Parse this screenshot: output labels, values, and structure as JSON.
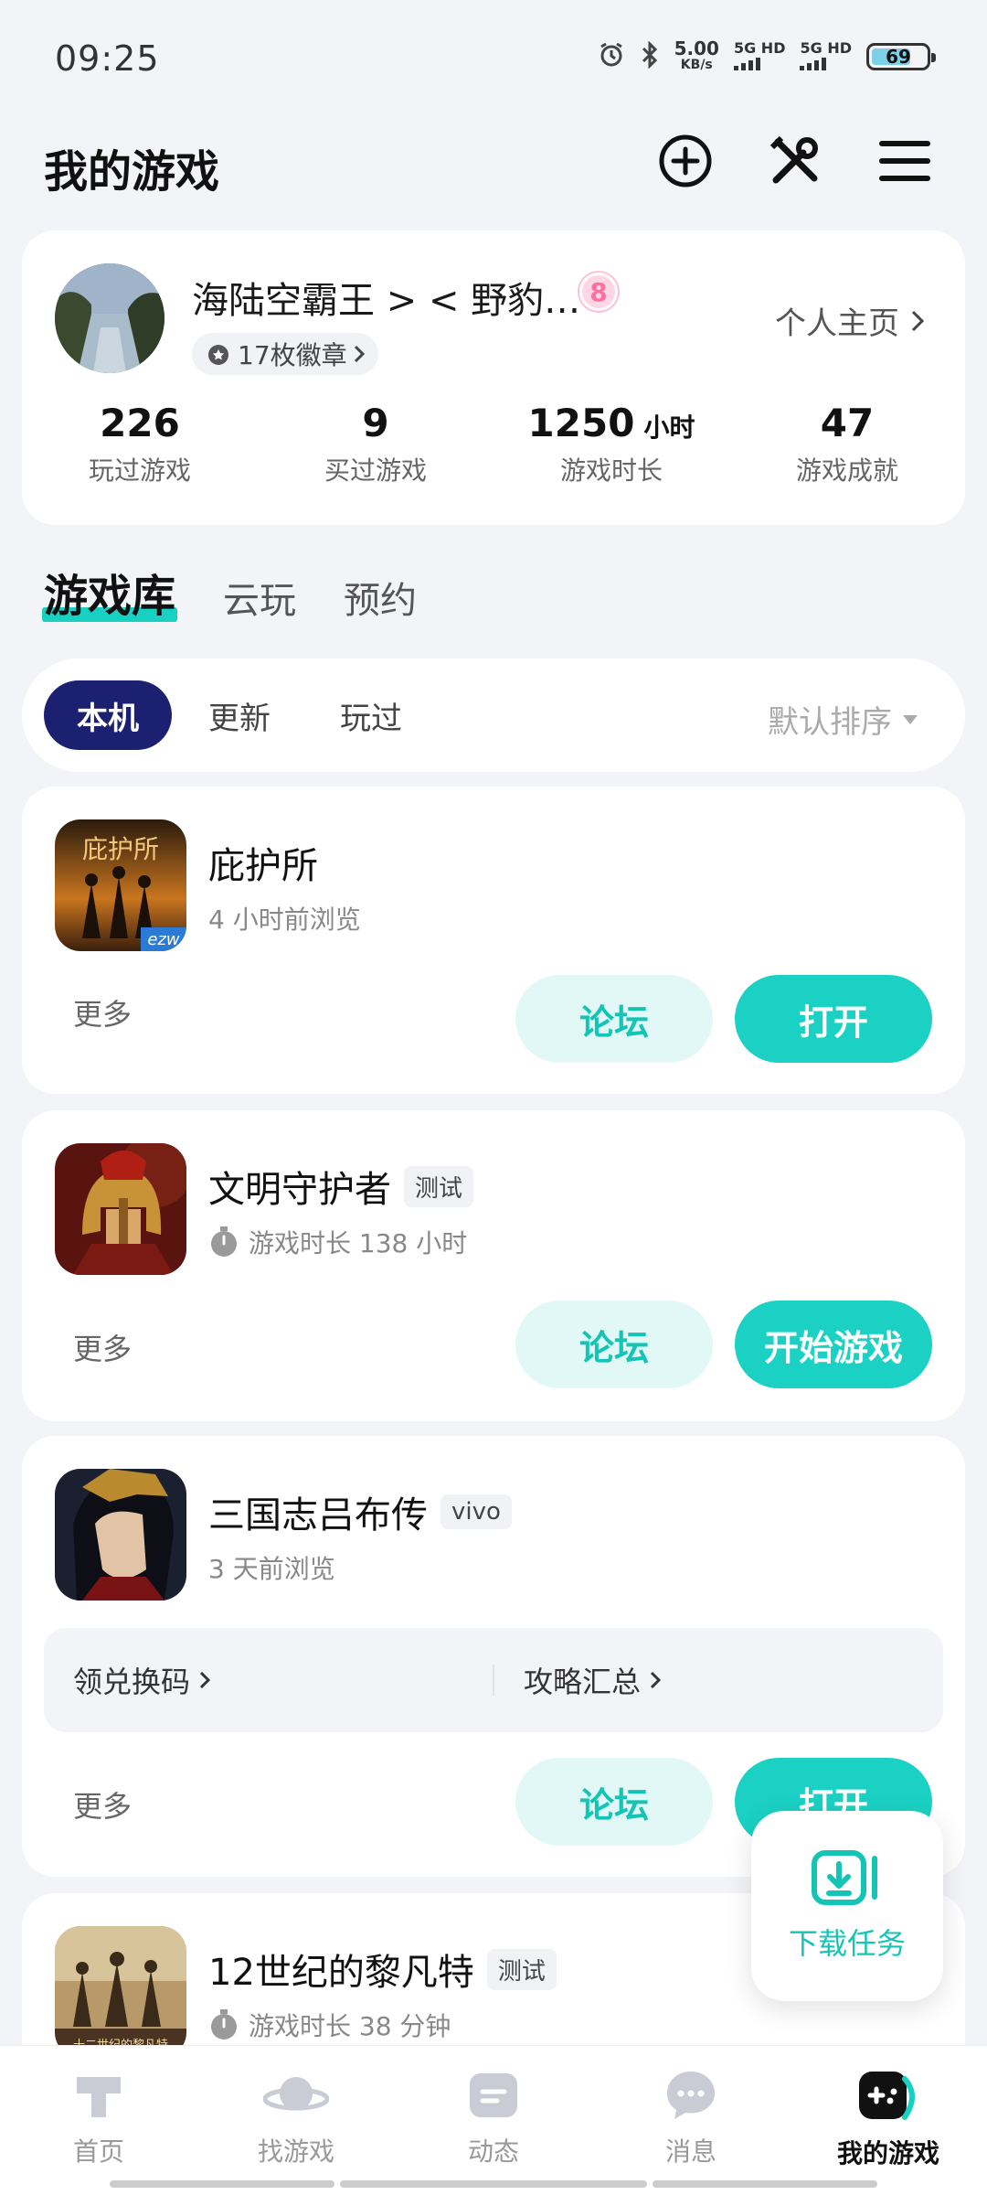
{
  "status_bar": {
    "time": "09:25",
    "speed_value": "5.00",
    "speed_unit": "KB/s",
    "net1": "5G HD",
    "net2": "5G HD",
    "battery": "69"
  },
  "header": {
    "title": "我的游戏",
    "icons": [
      "add-circle-icon",
      "tools-icon",
      "menu-icon"
    ]
  },
  "profile": {
    "name": "海陆空霸王 > < 野豹…",
    "level": "8",
    "badges": "17枚徽章",
    "homepage": "个人主页",
    "stats": [
      {
        "value": "226",
        "unit": "",
        "label": "玩过游戏"
      },
      {
        "value": "9",
        "unit": "",
        "label": "买过游戏"
      },
      {
        "value": "1250",
        "unit": "小时",
        "label": "游戏时长"
      },
      {
        "value": "47",
        "unit": "",
        "label": "游戏成就"
      }
    ]
  },
  "main_tabs": [
    "游戏库",
    "云玩",
    "预约"
  ],
  "filter": {
    "chips": [
      "本机",
      "更新",
      "玩过"
    ],
    "sort": "默认排序"
  },
  "games": [
    {
      "name": "庇护所",
      "tag": "",
      "sub": "4 小时前浏览",
      "more": "更多",
      "forum": "论坛",
      "action": "打开",
      "icon_text": "庇护所",
      "icon_corner": "ezw"
    },
    {
      "name": "文明守护者",
      "tag": "测试",
      "sub": "游戏时长 138 小时",
      "more": "更多",
      "forum": "论坛",
      "action": "开始游戏"
    },
    {
      "name": "三国志吕布传",
      "tag": "vivo",
      "sub": "3 天前浏览",
      "links": [
        "领兑换码",
        "攻略汇总"
      ],
      "more": "更多",
      "forum": "论坛",
      "action": "打开"
    },
    {
      "name": "12世纪的黎凡特",
      "tag": "测试",
      "sub": "游戏时长 38 分钟",
      "icon_text": "十二世纪的黎凡特"
    }
  ],
  "float_button": {
    "label": "下载任务"
  },
  "bottom_nav": [
    {
      "label": "首页",
      "icon": "home-icon",
      "active": false
    },
    {
      "label": "找游戏",
      "icon": "planet-icon",
      "active": false
    },
    {
      "label": "动态",
      "icon": "feed-icon",
      "active": false
    },
    {
      "label": "消息",
      "icon": "message-icon",
      "active": false
    },
    {
      "label": "我的游戏",
      "icon": "gamepad-icon",
      "active": true
    }
  ],
  "colors": {
    "accent": "#1ad1c3",
    "accent_light": "#e2f8f6",
    "chip_active": "#1c2070",
    "background": "#f3f4f8"
  }
}
